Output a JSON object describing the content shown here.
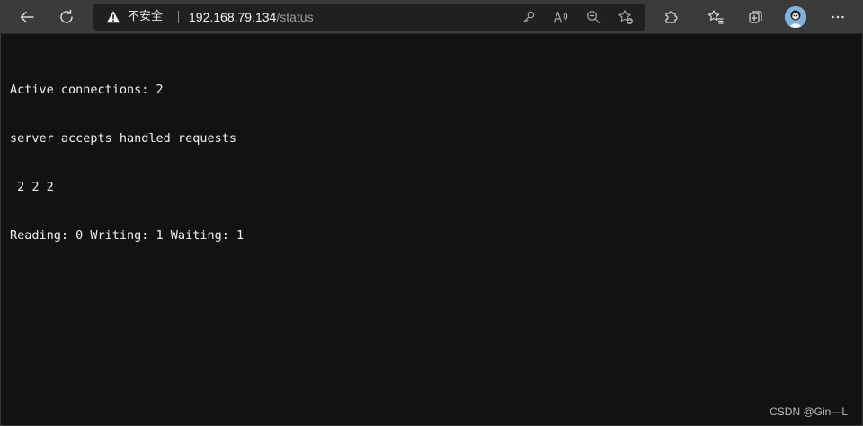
{
  "browser": {
    "security_label": "不安全",
    "url_host": "192.168.79.134",
    "url_path": "/status",
    "icons": {
      "back": "back-arrow-icon",
      "refresh": "refresh-icon",
      "warning": "warning-triangle-icon",
      "key": "key-icon",
      "read_aloud": "read-aloud-icon",
      "zoom": "zoom-in-icon",
      "add_favorite": "add-favorite-icon",
      "extensions": "puzzle-extensions-icon",
      "favorites": "favorites-star-list-icon",
      "collections": "collections-icon",
      "profile": "profile-avatar",
      "menu": "more-menu-icon"
    }
  },
  "page": {
    "lines": [
      "Active connections: 2",
      "server accepts handled requests",
      " 2 2 2",
      "Reading: 0 Writing: 1 Waiting: 1"
    ]
  },
  "watermark": "CSDN @Gin—L",
  "colors": {
    "page_background": "#121212",
    "toolbar_background": "#3b3b3b",
    "address_bar_background": "#202020",
    "text": "#f0f0f0"
  }
}
